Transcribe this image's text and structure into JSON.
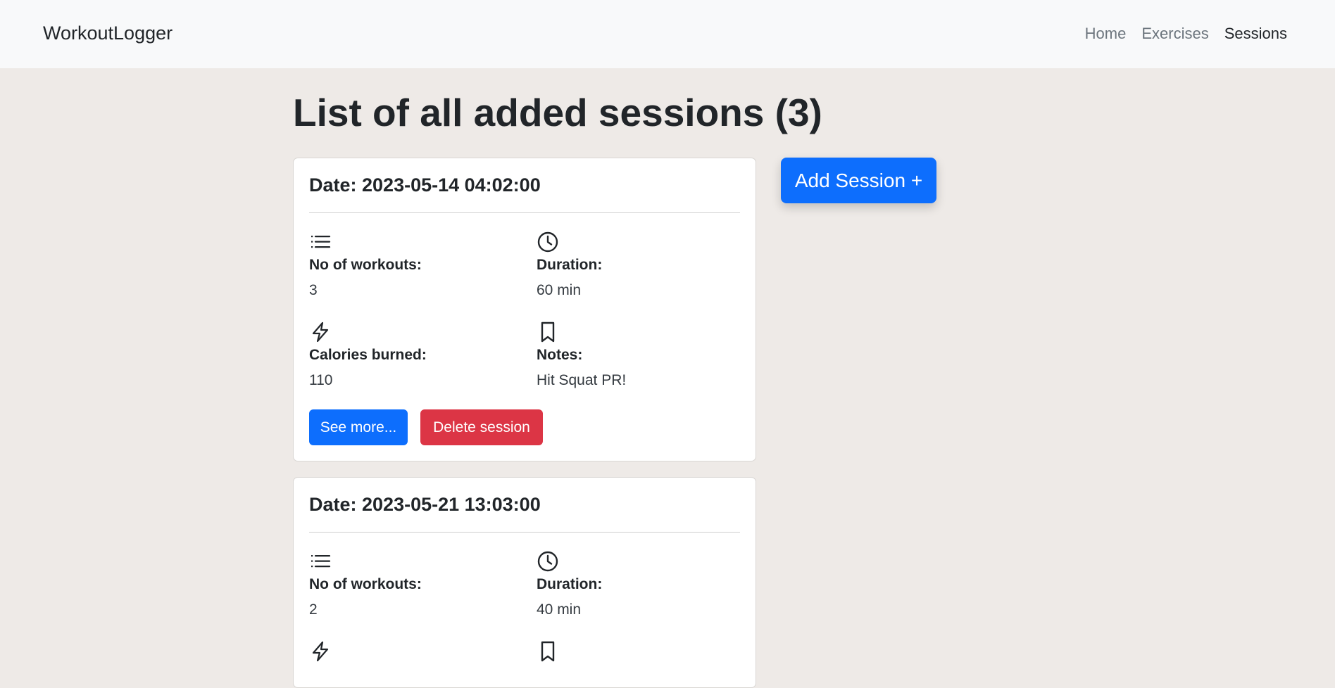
{
  "navbar": {
    "brand": "WorkoutLogger",
    "links": [
      {
        "label": "Home",
        "active": false
      },
      {
        "label": "Exercises",
        "active": false
      },
      {
        "label": "Sessions",
        "active": true
      }
    ]
  },
  "page": {
    "title": "List of all added sessions (3)",
    "add_button": "Add Session +"
  },
  "stat_labels": {
    "workouts": "No of workouts:",
    "duration": "Duration:",
    "calories": "Calories burned:",
    "notes": "Notes:"
  },
  "icons": {
    "workouts": "list-icon",
    "duration": "clock-icon",
    "calories": "lightning-icon",
    "notes": "bookmark-icon"
  },
  "sessions": [
    {
      "date": "Date: 2023-05-14 04:02:00",
      "workouts": "3",
      "duration": "60 min",
      "calories": "110",
      "notes": "Hit Squat PR!",
      "see_more": "See more...",
      "delete": "Delete session"
    },
    {
      "date": "Date: 2023-05-21 13:03:00",
      "workouts": "2",
      "duration": "40 min"
    }
  ],
  "colors": {
    "primary": "#0d6efd",
    "danger": "#dc3545",
    "background": "#eeeae7",
    "navbar": "#f8f9fa"
  }
}
